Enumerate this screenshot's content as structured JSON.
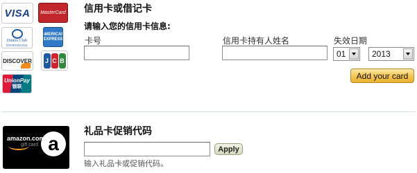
{
  "card_logos": {
    "visa": "VISA",
    "mastercard": "MasterCard",
    "diners_line1": "Diners Club",
    "diners_line2": "INTERNATIONAL",
    "amex": "AMERICAN EXPRESS",
    "discover": "DISCOVER",
    "jcb": [
      "J",
      "C",
      "B"
    ],
    "jcb_colors": [
      "#1a5aa6",
      "#d3202d",
      "#2e8b3d"
    ],
    "unionpay_line1": "UnionPay",
    "unionpay_line2": "银联"
  },
  "credit_card": {
    "section_title": "信用卡或借记卡",
    "prompt": "请输入您的信用卡信息:",
    "card_number_label": "卡号",
    "card_number_value": "",
    "cardholder_label": "信用卡持有人姓名",
    "cardholder_value": "",
    "expiry_label": "失效日期",
    "expiry_month": "01",
    "expiry_year": "2013",
    "add_button": "Add your card"
  },
  "gift_card": {
    "image_brand": "amazon.com",
    "image_sub": "gift card",
    "image_glyph": "a",
    "section_title": "礼品卡促销代码",
    "code_value": "",
    "apply_button": "Apply",
    "helper": "输入礼品卡或促销代码。"
  },
  "colors": {
    "add_button": "#f3c44e",
    "divider": "#cfe3e3",
    "apply_button": "#d6d9bd"
  }
}
